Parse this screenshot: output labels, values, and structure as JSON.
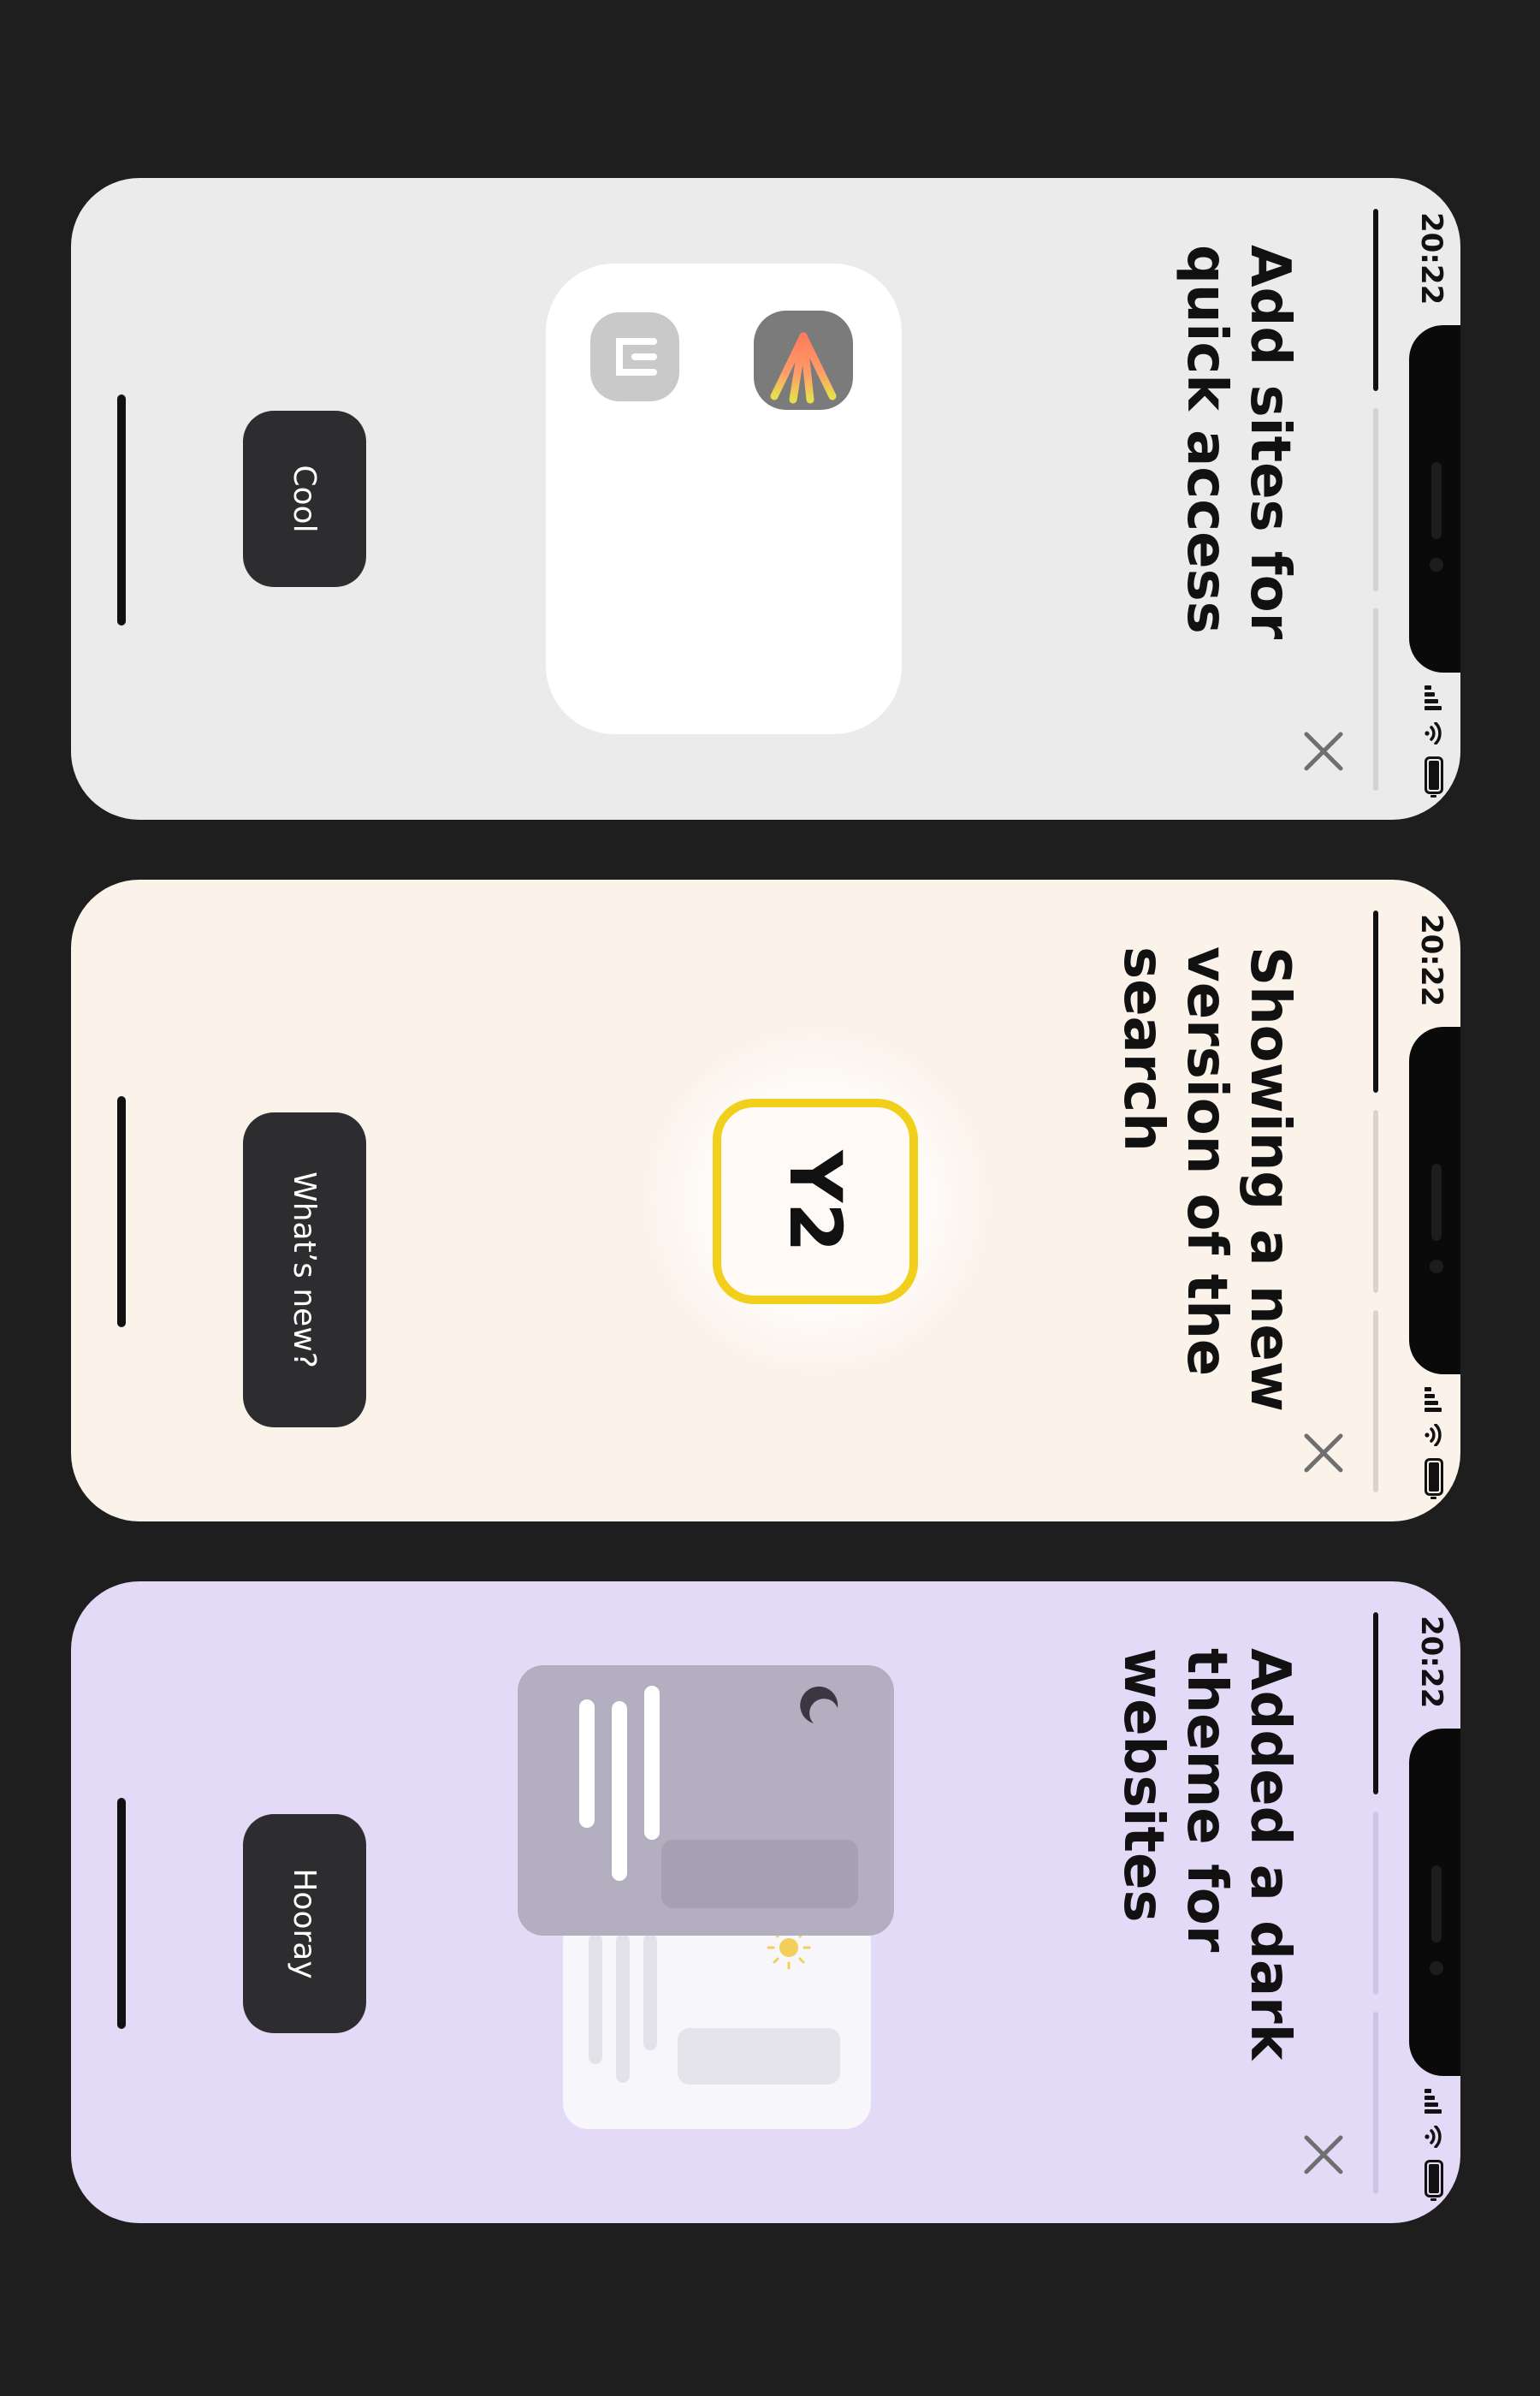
{
  "status": {
    "time": "20:22"
  },
  "cards": [
    {
      "title": "Add sites for quick access",
      "button": "Cool",
      "bg": "#ebebeb",
      "progress": [
        1.0,
        0,
        0
      ],
      "track_color": "#d2d2d2"
    },
    {
      "title": "Showing a new version of the search",
      "button": "What’s new?",
      "logo_text": "Y2",
      "bg": "#fbf2ea",
      "logo_border": "#f1cf1a",
      "progress": [
        1.0,
        0,
        0
      ],
      "track_color": "#ddd3cc"
    },
    {
      "title": "Added a dark theme for websites",
      "button": "Hooray",
      "bg": "#e3daf8",
      "progress": [
        1.0,
        0,
        0
      ],
      "track_color": "#cec5e4"
    }
  ],
  "icons": {
    "close": "close-icon",
    "signal": "cellular-signal-icon",
    "wifi": "wifi-icon",
    "battery": "battery-icon",
    "sun": "sun-icon",
    "moon": "moon-icon"
  }
}
